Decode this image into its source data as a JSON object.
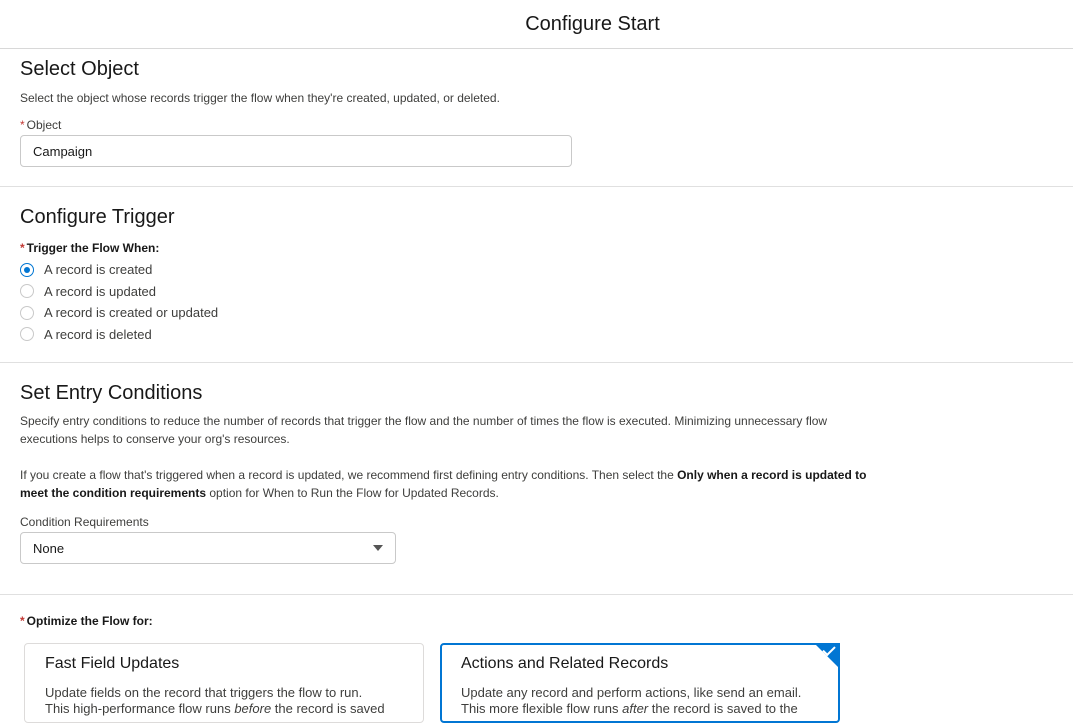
{
  "header": {
    "title": "Configure Start"
  },
  "select_object": {
    "title": "Select Object",
    "description": "Select the object whose records trigger the flow when they're created, updated, or deleted.",
    "required_mark": "*",
    "object_label": "Object",
    "object_value": "Campaign"
  },
  "configure_trigger": {
    "title": "Configure Trigger",
    "required_mark": "*",
    "label": "Trigger the Flow When:",
    "options": [
      {
        "label": "A record is created",
        "checked": true
      },
      {
        "label": "A record is updated",
        "checked": false
      },
      {
        "label": "A record is created or updated",
        "checked": false
      },
      {
        "label": "A record is deleted",
        "checked": false
      }
    ]
  },
  "entry_conditions": {
    "title": "Set Entry Conditions",
    "paragraph1": "Specify entry conditions to reduce the number of records that trigger the flow and the number of times the flow is executed. Minimizing unnecessary flow executions helps to conserve your org's resources.",
    "paragraph2_pre": "If you create a flow that's triggered when a record is updated, we recommend first defining entry conditions. Then select the ",
    "paragraph2_bold": "Only when a record is updated to meet the condition requirements",
    "paragraph2_post": " option for When to Run the Flow for Updated Records.",
    "condition_label": "Condition Requirements",
    "condition_value": "None"
  },
  "optimize": {
    "required_mark": "*",
    "label": "Optimize the Flow for:",
    "cards": [
      {
        "title": "Fast Field Updates",
        "line1": "Update fields on the record that triggers the flow to run.",
        "line2_pre": "This high-performance flow runs ",
        "line2_em": "before",
        "line2_post": " the record is saved",
        "selected": false
      },
      {
        "title": "Actions and Related Records",
        "line1": "Update any record and perform actions, like send an email.",
        "line2_pre": "This more flexible flow runs ",
        "line2_em": "after",
        "line2_post": " the record is saved to the",
        "selected": true
      }
    ]
  },
  "colors": {
    "brand": "#0176d3",
    "required": "#c23934"
  }
}
